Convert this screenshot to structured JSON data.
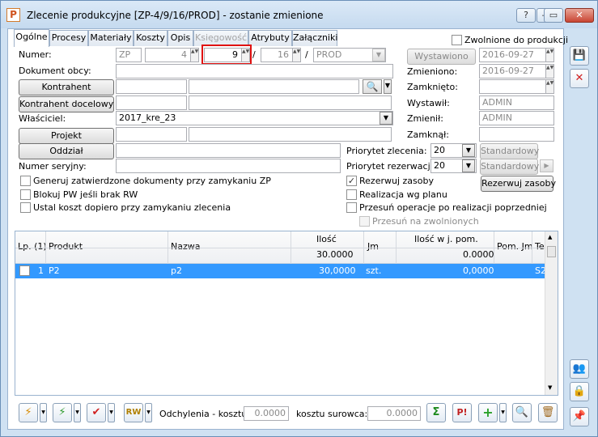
{
  "window": {
    "title": "Zlecenie produkcyjne  [ZP-4/9/16/PROD] - zostanie zmienione",
    "app_icon": "P",
    "buttons": [
      "?",
      "—",
      "▭",
      "✕"
    ]
  },
  "tabs": [
    "Ogólne",
    "Procesy",
    "Materiały",
    "Koszty",
    "Opis",
    "Księgowość",
    "Atrybuty",
    "Załączniki"
  ],
  "released": {
    "label": "Zwolnione do produkcji"
  },
  "form": {
    "numer_label": "Numer:",
    "numer_prefix": "ZP",
    "numer_1": "4",
    "numer_2": "9",
    "numer_3": "16",
    "numer_sep": "/",
    "numer_series": "PROD",
    "dokument_obcy_label": "Dokument obcy:",
    "kontrahent_button": "Kontrahent",
    "kontrahent_docelowy_button": "Kontrahent docelowy",
    "wlasciciel_label": "Właściciel:",
    "wlasciciel_value": "2017_kre_23",
    "projekt_button": "Projekt",
    "oddzial_button": "Oddział",
    "numer_seryjny_label": "Numer seryjny:",
    "wystawiono_button": "Wystawiono",
    "wystawiono_date": "2016-09-27",
    "zmieniono_label": "Zmieniono:",
    "zmieniono_date": "2016-09-27",
    "zamknieto_label": "Zamknięto:",
    "wystawil_label": "Wystawił:",
    "wystawil_value": "ADMIN",
    "zmienil_label": "Zmienił:",
    "zmienil_value": "ADMIN",
    "zamknal_label": "Zamknął:",
    "priorytet_zlecenia_label": "Priorytet zlecenia:",
    "priorytet_zlecenia_value": "20",
    "priorytet_zlecenia_btn": "Standardowy",
    "priorytet_rezerwacji_label": "Priorytet rezerwacji:",
    "priorytet_rezerwacji_value": "20",
    "priorytet_rezerwacji_btn": "Standardowy",
    "rezerwuj_btn": "Rezerwuj zasoby"
  },
  "checkboxes": {
    "generuj": "Generuj zatwierdzone dokumenty przy zamykaniu ZP",
    "blokuj": "Blokuj PW jeśli brak RW",
    "ustal": "Ustal koszt dopiero przy zamykaniu zlecenia",
    "rezerwuj": "Rezerwuj zasoby",
    "realizacja": "Realizacja wg planu",
    "przesun": "Przesuń operacje po realizacji poprzedniej",
    "przesun_zwolnionych": "Przesuń na zwolnionych"
  },
  "grid": {
    "headers": {
      "lp": "Lp. (1)",
      "produkt": "Produkt",
      "nazwa": "Nazwa",
      "ilosc": "Ilość",
      "ilosc_total": "30.0000",
      "jm": "Jm",
      "ilosc_pom": "Ilość w j. pom.",
      "ilosc_pom_total": "0.0000",
      "pom_jm": "Pom. Jm",
      "te": "Te"
    },
    "rows": [
      {
        "lp": "1",
        "produkt": "P2",
        "nazwa": "p2",
        "ilosc": "30,0000",
        "jm": "szt.",
        "ilosc_pom": "0,0000",
        "te": "S2"
      }
    ]
  },
  "bottom": {
    "odchylenia_label": "Odchylenia - kosztu:",
    "odchylenia_value": "0.0000",
    "kosztu_surowca_label": "kosztu surowca:",
    "kosztu_surowca_value": "0.0000"
  },
  "colors": {
    "accent": "#3399ff",
    "highlight": "#e01010",
    "window_bg": "#cfe1f2"
  }
}
